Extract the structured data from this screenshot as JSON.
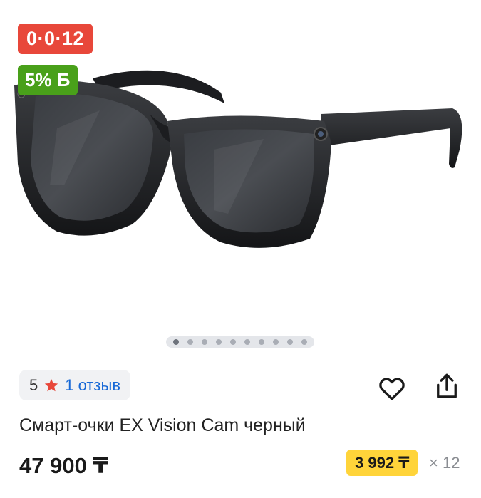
{
  "badges": {
    "installment": "0·0·12",
    "bonus": "5% Б"
  },
  "gallery": {
    "image": "smart-glasses-photo",
    "dots_count": 10,
    "active_dot": 1
  },
  "rating": {
    "value": "5",
    "reviews": "1 отзыв"
  },
  "actions": {
    "favorite_icon": "heart-icon",
    "share_icon": "share-icon"
  },
  "product": {
    "title": "Смарт-очки EX Vision Cam черный",
    "price": "47 900 ₸"
  },
  "installment": {
    "monthly": "3 992 ₸",
    "months": "× 12"
  },
  "colors": {
    "installment_badge": "#e8473a",
    "bonus_badge": "#49a01a",
    "star": "#e8473a",
    "link": "#1668d6",
    "installment_price_bg": "#ffd43a"
  }
}
